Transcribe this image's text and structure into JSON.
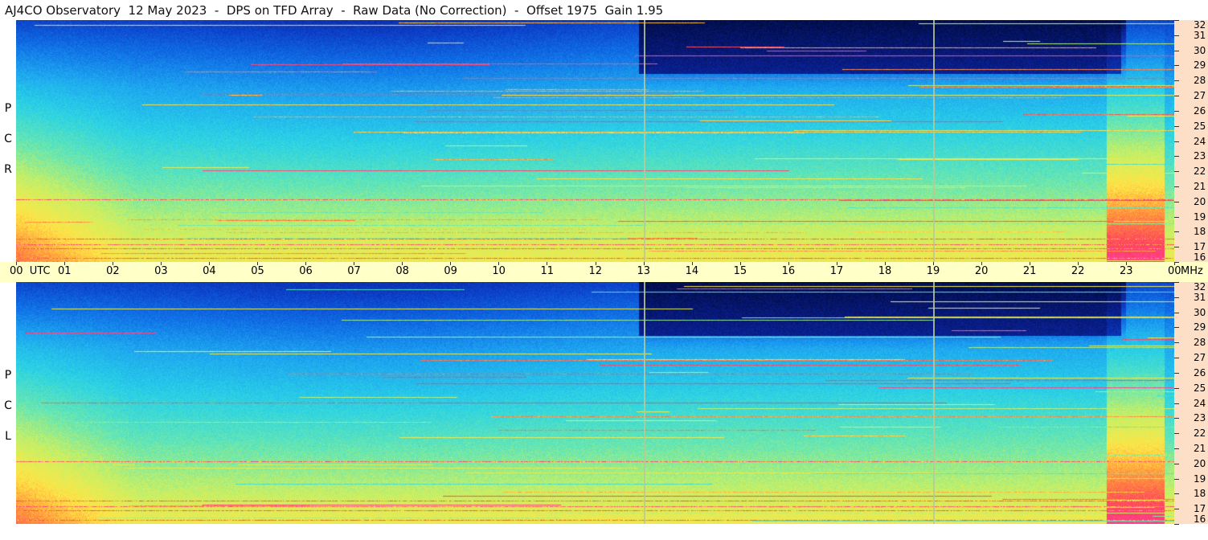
{
  "title": "AJ4CO Observatory  12 May 2023  -  DPS on TFD Array  -  Raw Data (No Correction)  -  Offset 1975  Gain 1.95",
  "chart_data": {
    "type": "heatmap",
    "title": "AJ4CO Observatory  12 May 2023  -  DPS on TFD Array  -  Raw Data (No Correction)  -  Offset 1975  Gain 1.95",
    "x_axis": {
      "ticks": [
        "00",
        "01",
        "02",
        "03",
        "04",
        "05",
        "06",
        "07",
        "08",
        "09",
        "10",
        "11",
        "12",
        "13",
        "14",
        "15",
        "16",
        "17",
        "18",
        "19",
        "20",
        "21",
        "22",
        "23",
        "00"
      ],
      "first_tick_suffix": "UTC",
      "range": [
        0,
        24
      ]
    },
    "y_axis": {
      "unit": "MHz",
      "ticks": [
        16,
        17,
        18,
        19,
        20,
        21,
        22,
        23,
        24,
        25,
        26,
        27,
        28,
        29,
        30,
        31,
        32
      ],
      "range": [
        16,
        32
      ]
    },
    "panels": [
      {
        "polarization": [
          "R",
          "C",
          "P"
        ]
      },
      {
        "polarization": [
          "L",
          "C",
          "P"
        ]
      }
    ],
    "vertical_markers_utc": [
      13.0,
      19.0
    ],
    "colormap": [
      "#000a3c",
      "#0a1e8c",
      "#0c3ec8",
      "#1070e6",
      "#1ea6f0",
      "#2ad2e6",
      "#64e6b4",
      "#c8f064",
      "#ffe646",
      "#ff8c3c",
      "#ff3c64",
      "#ff50c8"
    ]
  }
}
